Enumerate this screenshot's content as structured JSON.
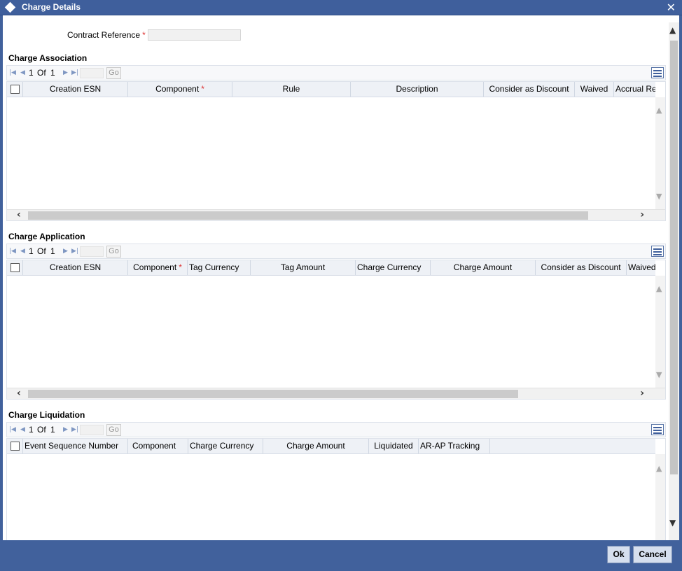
{
  "window": {
    "title": "Charge Details",
    "close_symbol": "✕"
  },
  "contract_reference": {
    "label": "Contract Reference",
    "required_mark": "*",
    "value": ""
  },
  "sections": {
    "charge_association": {
      "title": "Charge Association",
      "pager": {
        "current": "1",
        "of_label": "Of",
        "total": "1",
        "go_label": "Go"
      },
      "columns": [
        "Creation ESN",
        "Component",
        "Rule",
        "Description",
        "Consider as Discount",
        "Waived",
        "Accrual Re"
      ],
      "required_mark": "*"
    },
    "charge_application": {
      "title": "Charge Application",
      "pager": {
        "current": "1",
        "of_label": "Of",
        "total": "1",
        "go_label": "Go"
      },
      "columns": [
        "Creation ESN",
        "Component",
        "Tag Currency",
        "Tag Amount",
        "Charge Currency",
        "Charge Amount",
        "Consider as Discount",
        "Waived"
      ],
      "required_mark": "*"
    },
    "charge_liquidation": {
      "title": "Charge Liquidation",
      "pager": {
        "current": "1",
        "of_label": "Of",
        "total": "1",
        "go_label": "Go"
      },
      "columns": [
        "Event Sequence Number",
        "Component",
        "Charge Currency",
        "Charge Amount",
        "Liquidated",
        "AR-AP Tracking"
      ]
    }
  },
  "icons": {
    "first": "first-page-icon",
    "prev": "previous-page-icon",
    "next": "next-page-icon",
    "last": "last-page-icon",
    "grid": "grid-settings-icon"
  },
  "footer": {
    "ok_label": "Ok",
    "cancel_label": "Cancel"
  },
  "colors": {
    "header_blue": "#41619c",
    "required_red": "#dd3333"
  }
}
